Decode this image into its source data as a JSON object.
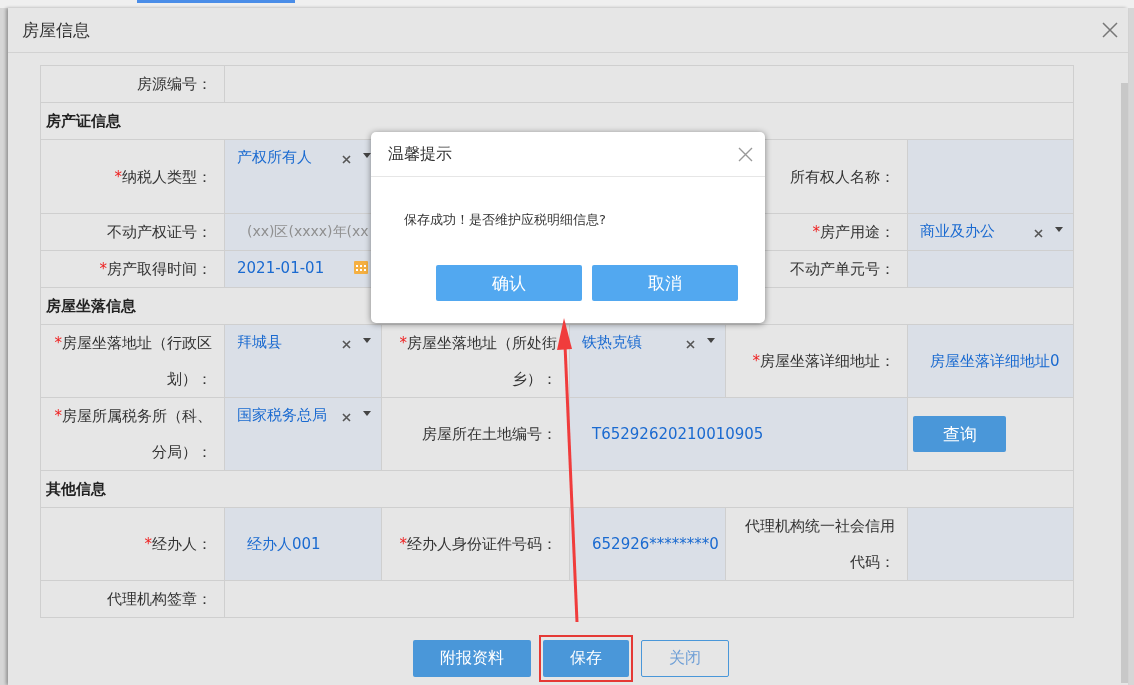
{
  "window": {
    "title": "房屋信息"
  },
  "rows": [
    {
      "kind": "fields",
      "cells": [
        {
          "kind": "label",
          "text": "房源编号："
        },
        {
          "kind": "blank"
        }
      ]
    },
    {
      "kind": "section",
      "title": "房产证信息"
    },
    {
      "kind": "fields",
      "cells": [
        {
          "kind": "label",
          "text": "纳税人类型：",
          "required_mark": "*"
        },
        {
          "kind": "select",
          "value": "产权所有人"
        },
        {
          "kind": "blank"
        },
        {
          "kind": "blank"
        },
        {
          "kind": "label",
          "text": "所有权人名称："
        },
        {
          "kind": "input"
        }
      ]
    },
    {
      "kind": "fields",
      "cells": [
        {
          "kind": "label",
          "text": "不动产权证号："
        },
        {
          "kind": "input",
          "placeholder": "(xx)区(xxxx)年(xx"
        },
        {
          "kind": "blank"
        },
        {
          "kind": "blank"
        },
        {
          "kind": "label",
          "text": "房产用途：",
          "required_mark": "*"
        },
        {
          "kind": "select",
          "value": "商业及办公"
        }
      ]
    },
    {
      "kind": "fields",
      "cells": [
        {
          "kind": "label",
          "text": "房产取得时间：",
          "required_mark": "*"
        },
        {
          "kind": "date",
          "value": "2021-01-01"
        },
        {
          "kind": "blank"
        },
        {
          "kind": "blank"
        },
        {
          "kind": "label",
          "text": "不动产单元号："
        },
        {
          "kind": "input"
        }
      ]
    },
    {
      "kind": "section",
      "title": "房屋坐落信息"
    },
    {
      "kind": "fields",
      "cells": [
        {
          "kind": "label",
          "text": "房屋坐落地址（行政区划）：",
          "required_mark": "*"
        },
        {
          "kind": "select",
          "value": "拜城县"
        },
        {
          "kind": "label",
          "text": "房屋坐落地址（所处街乡）：",
          "required_mark": "*"
        },
        {
          "kind": "select",
          "value": "铁热克镇"
        },
        {
          "kind": "label",
          "text": "房屋坐落详细地址：",
          "required_mark": "*"
        },
        {
          "kind": "input",
          "value": "房屋坐落详细地址0"
        }
      ]
    },
    {
      "kind": "fields",
      "cells": [
        {
          "kind": "label",
          "text": "房屋所属税务所（科、分局）：",
          "required_mark": "*"
        },
        {
          "kind": "select",
          "value": "国家税务总局"
        },
        {
          "kind": "label",
          "text": "房屋所在土地编号："
        },
        {
          "kind": "input",
          "value": "T65292620210010905"
        },
        {
          "kind": "button",
          "text": "查询"
        }
      ]
    },
    {
      "kind": "section",
      "title": "其他信息"
    },
    {
      "kind": "fields",
      "cells": [
        {
          "kind": "label",
          "text": "经办人：",
          "required_mark": "*"
        },
        {
          "kind": "input",
          "value": "经办人001"
        },
        {
          "kind": "label",
          "text": "经办人身份证件号码：",
          "required_mark": "*"
        },
        {
          "kind": "input",
          "value": "652926********0"
        },
        {
          "kind": "label",
          "text": "代理机构统一社会信用代码："
        },
        {
          "kind": "input"
        }
      ]
    },
    {
      "kind": "fields",
      "cells": [
        {
          "kind": "label",
          "text": "代理机构签章："
        },
        {
          "kind": "blank"
        }
      ]
    }
  ],
  "buttons": [
    {
      "text": "附报资料",
      "kind": "primary",
      "highlighted": false
    },
    {
      "text": "保存",
      "kind": "primary",
      "highlighted": true
    },
    {
      "text": "关闭",
      "kind": "outline",
      "highlighted": false
    }
  ],
  "dialog": {
    "title": "温馨提示",
    "message": "保存成功！是否维护应税明细信息?",
    "buttons": [
      "确认",
      "取消"
    ]
  }
}
